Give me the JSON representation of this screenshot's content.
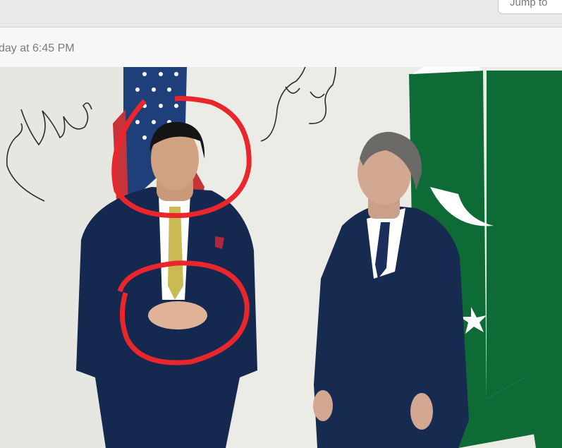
{
  "toolbar": {
    "jump_label": "Jump to"
  },
  "message": {
    "timestamp": "day at 6:45 PM"
  },
  "photo": {
    "description_icon": "photo-icon"
  },
  "colors": {
    "wall": "#ecece6",
    "suit": "#15284f",
    "flag_green": "#0f6b36",
    "annotation_red": "#e8262c"
  }
}
